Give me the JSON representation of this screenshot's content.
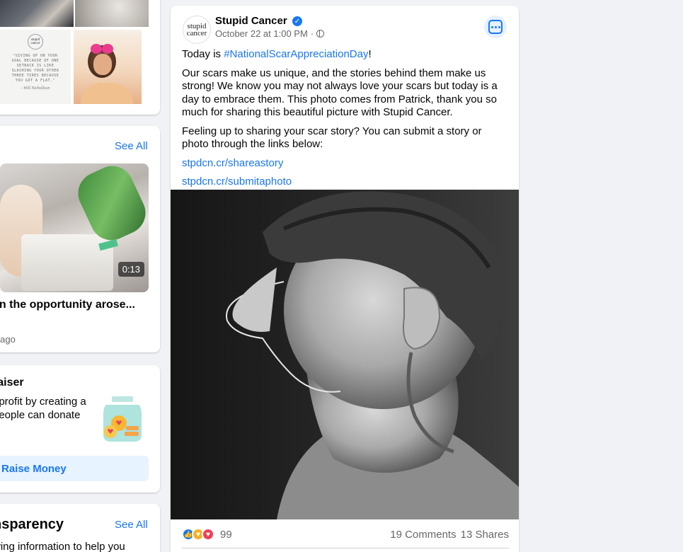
{
  "left_column": {
    "photos": {
      "quote_text": "\"GIVING UP ON YOUR GOAL BECAUSE OF ONE SETBACK IS LIKE SLASHING YOUR OTHER THREE TIRES BECAUSE YOU GOT A FLAT.\"",
      "quote_author": "- Will Nichollson",
      "logo_top": "stupid",
      "logo_bottom": "cancer"
    },
    "videos": {
      "see_all": "See All",
      "duration": "0:13",
      "title": "en the opportunity arose...",
      "time": "s ago"
    },
    "fundraiser": {
      "title": "raiser",
      "description": "nprofit by creating a people can donate",
      "button": "Raise Money"
    },
    "transparency": {
      "title": "nsparency",
      "see_all": "See All",
      "description": "wing information to help you"
    }
  },
  "post": {
    "page_name": "Stupid Cancer",
    "avatar_line1": "stupid",
    "avatar_line2": "cancer",
    "timestamp": "October 22 at 1:00 PM",
    "meta_separator": "·",
    "intro_prefix": "Today is ",
    "hashtag": "#NationalScarAppreciationDay",
    "intro_suffix": "!",
    "paragraph_1": "Our scars make us unique, and the stories behind them make us strong! We know you may not always love your scars but today is a day to embrace them. This photo comes from Patrick, thank you so much for sharing this beautiful picture with Stupid Cancer.",
    "paragraph_2": "Feeling up to sharing your scar story? You can submit a story or photo through the links below:",
    "link_1": "stpdcn.cr/shareastory",
    "link_2": "stpdcn.cr/submitaphoto",
    "reaction_count": "99",
    "comments": "19 Comments",
    "shares": "13 Shares"
  },
  "colors": {
    "accent": "#1877f2",
    "background": "#f0f2f5",
    "muted_text": "#65676b"
  }
}
